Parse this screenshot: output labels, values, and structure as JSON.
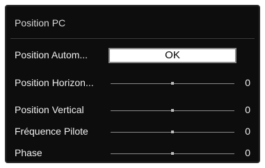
{
  "panel": {
    "title": "Position PC"
  },
  "items": [
    {
      "label": "Position Autom...",
      "button": "OK"
    },
    {
      "label": "Position Horizon...",
      "value": "0",
      "level": 0.5
    },
    {
      "label": "Position Vertical",
      "value": "0",
      "level": 0.5
    },
    {
      "label": "Fréquence Pilote",
      "value": "0",
      "level": 0.5
    },
    {
      "label": "Phase",
      "value": "0",
      "level": 0.5
    }
  ]
}
